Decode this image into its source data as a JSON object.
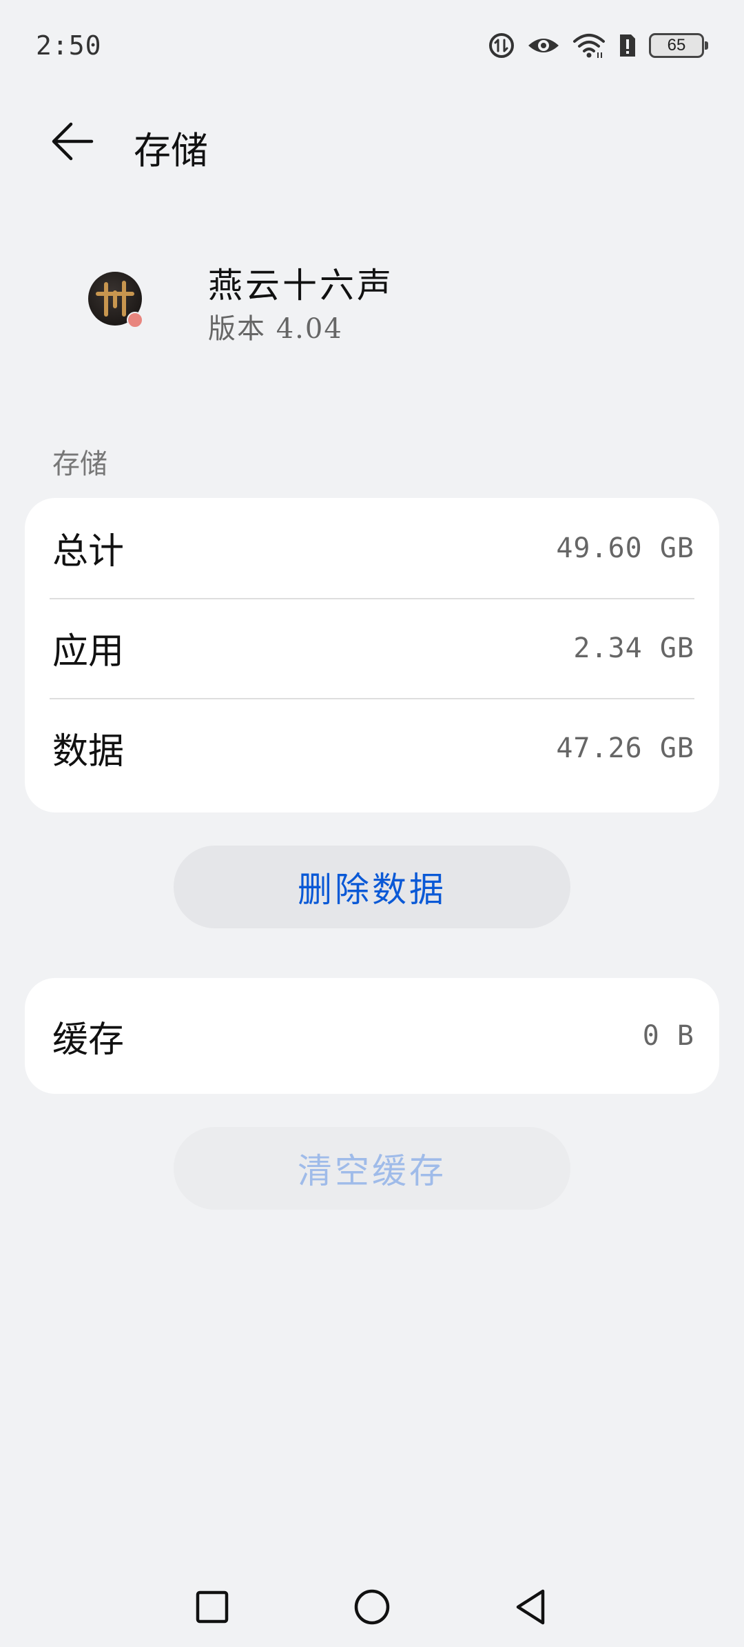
{
  "status_bar": {
    "time": "2:50",
    "battery_level": "65",
    "icons": [
      "data-saver-icon",
      "eye-comfort-icon",
      "wifi-icon",
      "sim-alert-icon",
      "battery-icon"
    ]
  },
  "header": {
    "back_icon": "arrow-left-icon",
    "title": "存储"
  },
  "app": {
    "name": "燕云十六声",
    "version": "版本 4.04"
  },
  "storage_section": {
    "label": "存储",
    "rows": [
      {
        "label": "总计",
        "value": "49.60 GB"
      },
      {
        "label": "应用",
        "value": "2.34 GB"
      },
      {
        "label": "数据",
        "value": "47.26 GB"
      }
    ]
  },
  "delete_data_button": {
    "label": "删除数据"
  },
  "cache_section": {
    "rows": [
      {
        "label": "缓存",
        "value": "0 B"
      }
    ]
  },
  "clear_cache_button": {
    "label": "清空缓存",
    "enabled": false
  },
  "colors": {
    "background": "#f1f2f4",
    "card": "#ffffff",
    "accent": "#0a59d6",
    "disabled_accent": "#9fbbe9"
  },
  "nav_bar": {
    "icons": [
      "recent-apps-icon",
      "home-icon",
      "back-triangle-icon"
    ]
  }
}
